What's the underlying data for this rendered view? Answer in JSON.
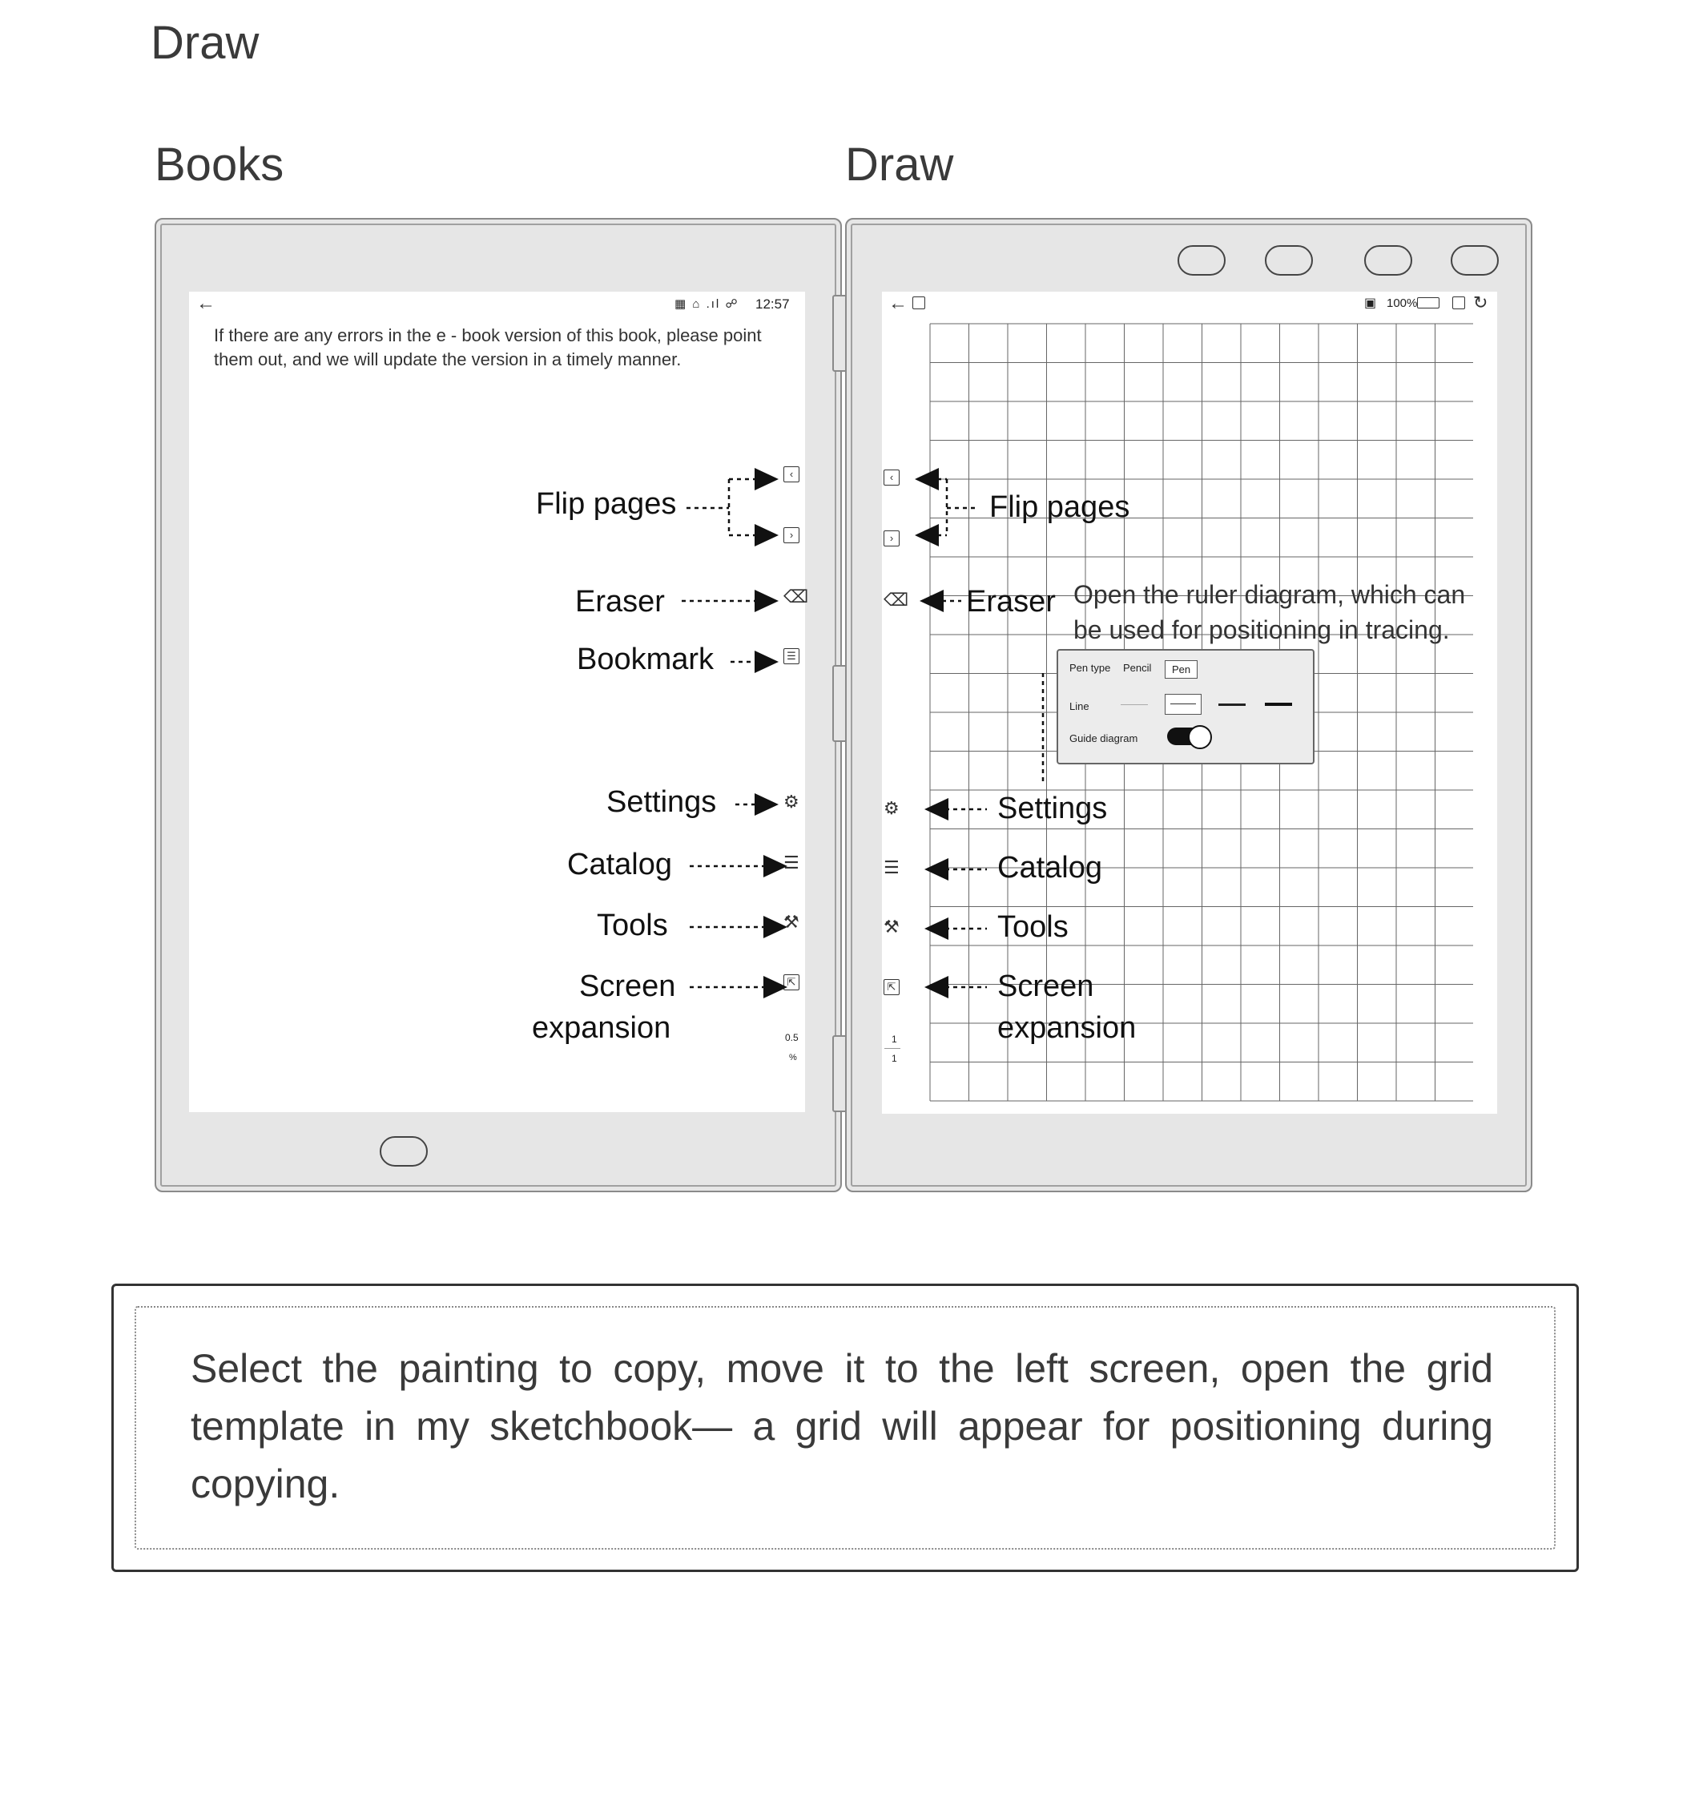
{
  "page_title": "Draw",
  "left_device": {
    "header": "Books",
    "status_time": "12:57",
    "notice": "If there are any errors in the e - book version of this book, please point them out, and we will update the version in a timely manner.",
    "progress_value": "0.5",
    "progress_unit": "%",
    "labels": {
      "flip_pages": "Flip pages",
      "eraser": "Eraser",
      "bookmark": "Bookmark",
      "settings": "Settings",
      "catalog": "Catalog",
      "tools": "Tools",
      "screen_expansion_line1": "Screen",
      "screen_expansion_line2": "expansion"
    }
  },
  "right_device": {
    "header": "Draw",
    "battery": "100%",
    "page_current": "1",
    "page_total": "1",
    "ruler_note_line1": "Open the ruler diagram, which can",
    "ruler_note_line2": "be used for positioning in tracing.",
    "popup": {
      "pen_type_label": "Pen type",
      "pencil_option": "Pencil",
      "pen_option": "Pen",
      "line_label": "Line",
      "guide_label": "Guide diagram",
      "guide_on": true
    },
    "labels": {
      "flip_pages": "Flip pages",
      "eraser": "Eraser",
      "settings": "Settings",
      "catalog": "Catalog",
      "tools": "Tools",
      "screen_expansion_line1": "Screen",
      "screen_expansion_line2": "expansion"
    }
  },
  "caption": "Select the painting to copy, move it to the left screen, open the grid template in my sketchbook— a grid will appear for positioning during copying."
}
